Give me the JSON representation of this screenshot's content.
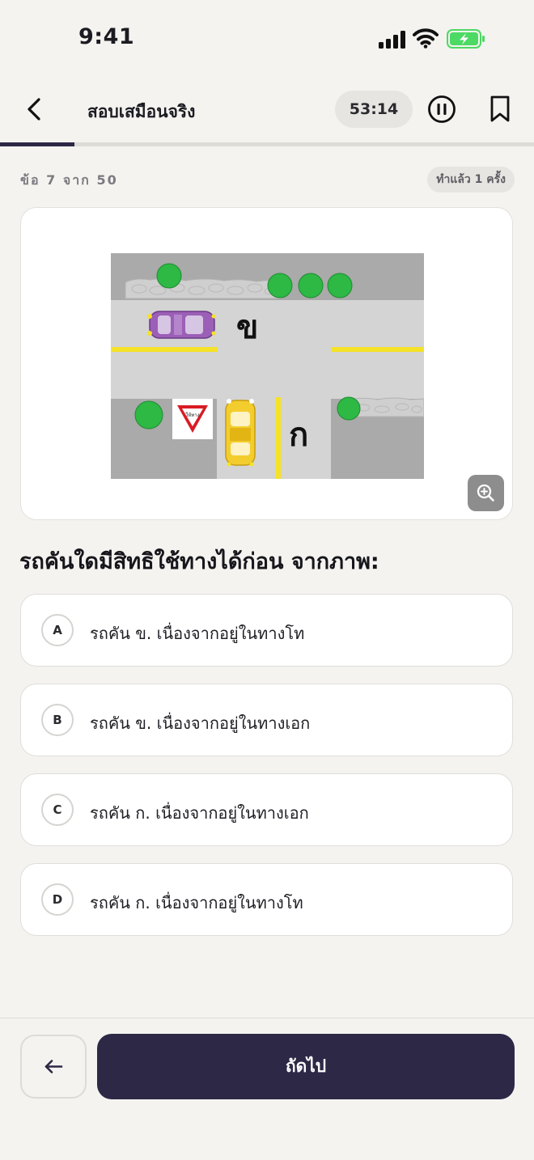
{
  "status_bar": {
    "time": "9:41"
  },
  "header": {
    "title": "สอบเสมือนจริง",
    "timer": "53:14",
    "progress_fraction": 0.14
  },
  "counter": {
    "label": "ข้อ 7 จาก 50",
    "attempts": "ทำแล้ว 1 ครั้ง"
  },
  "illustration": {
    "label_upper_car": "ข",
    "label_lower_car": "ก",
    "sign_text": "ให้ทาง"
  },
  "question": "รถคันใดมีสิทธิใช้ทางได้ก่อน จากภาพ:",
  "options": [
    {
      "letter": "A",
      "text": "รถคัน ข. เนื่องจากอยู่ในทางโท"
    },
    {
      "letter": "B",
      "text": "รถคัน ข. เนื่องจากอยู่ในทางเอก"
    },
    {
      "letter": "C",
      "text": "รถคัน ก. เนื่องจากอยู่ในทางเอก"
    },
    {
      "letter": "D",
      "text": "รถคัน ก. เนื่องจากอยู่ในทางโท"
    }
  ],
  "footer": {
    "next_label": "ถัดไป"
  },
  "colors": {
    "primary": "#2c2846",
    "background": "#f4f3ef",
    "battery": "#4cd964"
  }
}
